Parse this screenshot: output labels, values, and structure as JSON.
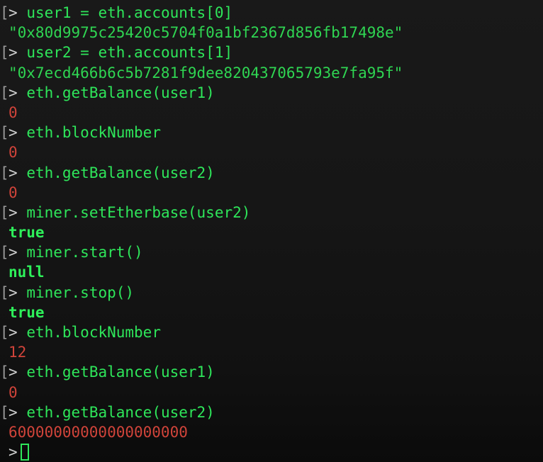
{
  "terminal": {
    "prompt_symbol": ">",
    "bracket_symbol": "[",
    "entries": [
      {
        "command": "user1 = eth.accounts[0]",
        "output": "\"0x80d9975c25420c5704f0a1bf2367d856fb17498e\"",
        "output_type": "str"
      },
      {
        "command": "user2 = eth.accounts[1]",
        "output": "\"0x7ecd466b6c5b7281f9dee820437065793e7fa95f\"",
        "output_type": "str"
      },
      {
        "command": "eth.getBalance(user1)",
        "output": "0",
        "output_type": "num"
      },
      {
        "command": "eth.blockNumber",
        "output": "0",
        "output_type": "num"
      },
      {
        "command": "eth.getBalance(user2)",
        "output": "0",
        "output_type": "num"
      },
      {
        "command": "miner.setEtherbase(user2)",
        "output": "true",
        "output_type": "kw"
      },
      {
        "command": "miner.start()",
        "output": "null",
        "output_type": "kw"
      },
      {
        "command": "miner.stop()",
        "output": "true",
        "output_type": "kw"
      },
      {
        "command": "eth.blockNumber",
        "output": "12",
        "output_type": "num"
      },
      {
        "command": "eth.getBalance(user1)",
        "output": "0",
        "output_type": "num"
      },
      {
        "command": "eth.getBalance(user2)",
        "output": "60000000000000000000",
        "output_type": "num"
      }
    ],
    "input_value": ""
  },
  "colors": {
    "background": "#161616",
    "command": "#2ee65a",
    "string_output": "#2fd552",
    "number_output": "#d1443a",
    "keyword_output": "#2ef05a"
  }
}
